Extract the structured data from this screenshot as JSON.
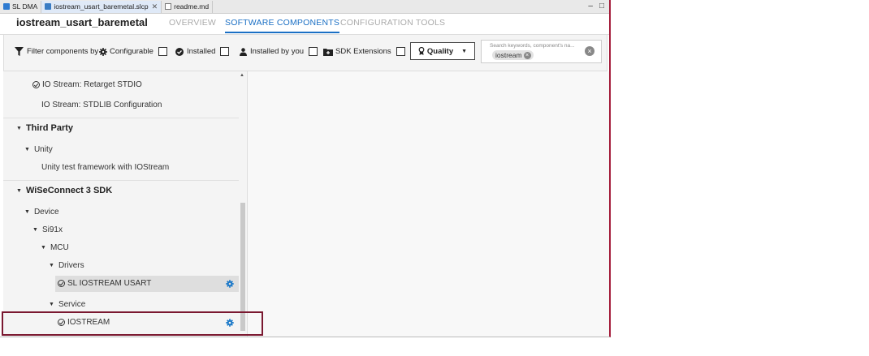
{
  "file_tabs": [
    {
      "label": "SL DMA",
      "icon": "dma-file-icon"
    },
    {
      "label": "iostream_usart_baremetal.slcp",
      "icon": "slcp-file-icon",
      "close": "✕"
    },
    {
      "label": "readme.md",
      "icon": "markdown-file-icon"
    }
  ],
  "window_buttons": {
    "minimize": "–",
    "maximize": "□"
  },
  "header": {
    "project_title": "iostream_usart_baremetal",
    "tabs": [
      "OVERVIEW",
      "SOFTWARE COMPONENTS",
      "CONFIGURATION TOOLS"
    ],
    "active_tab": "SOFTWARE COMPONENTS"
  },
  "filter": {
    "label": "Filter components by",
    "configurable": "Configurable",
    "installed": "Installed",
    "installed_by_you": "Installed by you",
    "sdk_extensions": "SDK Extensions",
    "quality": "Quality",
    "search_placeholder": "Search keywords, component's na...",
    "search_chip": "iostream"
  },
  "tree": {
    "retarget": "IO Stream: Retarget STDIO",
    "stdlib": "IO Stream: STDLIB Configuration",
    "third_party": "Third Party",
    "unity": "Unity",
    "unity_fw": "Unity test framework with IOStream",
    "wiseconnect": "WiSeConnect 3 SDK",
    "device": "Device",
    "si91x": "Si91x",
    "mcu": "MCU",
    "drivers": "Drivers",
    "sl_iostream_usart": "SL IOSTREAM USART",
    "service": "Service",
    "iostream": "IOSTREAM"
  },
  "colors": {
    "accent": "#1a6fc4",
    "focus_border": "#7a1830",
    "window_border": "#a41d3b"
  }
}
